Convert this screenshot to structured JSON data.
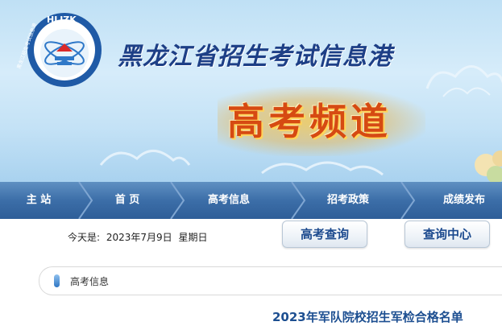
{
  "site": {
    "logo_text": "HLJZK",
    "logo_ring_text": "黑龙江招生考试信息港",
    "title": "黑龙江省招生考试信息港",
    "channel_title": "高考频道"
  },
  "nav": {
    "items": [
      {
        "label": "主 站"
      },
      {
        "label": "首 页"
      },
      {
        "label": "高考信息"
      },
      {
        "label": "招考政策"
      },
      {
        "label": "成绩发布"
      }
    ]
  },
  "date_bar": {
    "prefix": "今天是:",
    "date": "2023年7月9日",
    "weekday": "星期日"
  },
  "buttons": {
    "gaokao_query": "高考查询",
    "query_center": "查询中心"
  },
  "breadcrumb": {
    "label": "高考信息"
  },
  "article": {
    "title": "2023年军队院校招生军检合格名单"
  },
  "colors": {
    "nav_bg": "#3c6ea8",
    "title_blue": "#1d3f86",
    "channel_orange": "#d64a12",
    "article_title": "#1d4f91"
  },
  "icons": {
    "breadcrumb": "pill-marker-icon"
  }
}
